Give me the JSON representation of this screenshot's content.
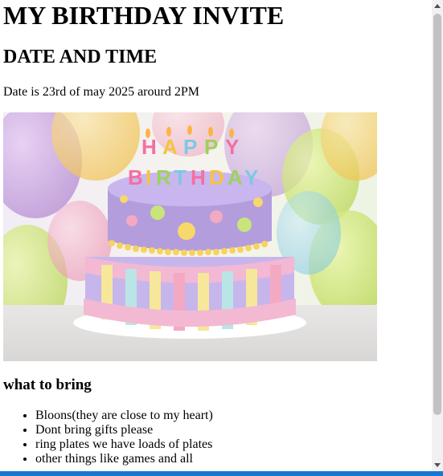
{
  "page": {
    "title": "MY BIRTHDAY INVITE",
    "datetime_heading": "DATE AND TIME",
    "date_text": "Date is 23rd of may 2025 arourd 2PM"
  },
  "image": {
    "icon": "birthday-cake-image",
    "cake_text": "HAPPY BIRTHDAY"
  },
  "bring": {
    "heading": "what to bring",
    "items": [
      "Bloons(they are close to my heart)",
      "Dont bring gifts please",
      "ring plates we have loads of plates",
      "other things like games and all"
    ]
  },
  "colors": {
    "accent_bar": "#1976d2",
    "scrollbar_track": "#f1f1f1",
    "scrollbar_thumb": "#c1c1c1"
  }
}
